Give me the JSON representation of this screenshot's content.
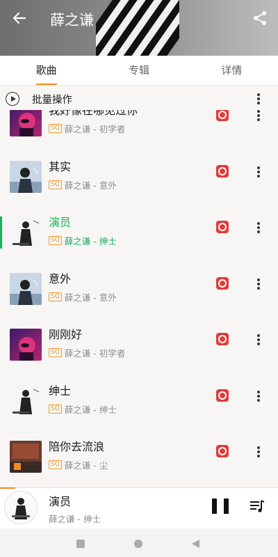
{
  "header": {
    "title": "薛之谦",
    "back_icon": "back-arrow-icon",
    "share_icon": "share-icon"
  },
  "tabs": [
    {
      "label": "歌曲",
      "active": true
    },
    {
      "label": "专辑",
      "active": false
    },
    {
      "label": "详情",
      "active": false
    }
  ],
  "batch": {
    "label": "批量操作"
  },
  "songs": [
    {
      "title": "我好像在哪见过你",
      "artist_album": "薛之谦 - 初学者",
      "quality": "SQ",
      "art": "art-pink",
      "playing": false
    },
    {
      "title": "其实",
      "artist_album": "薛之谦 - 意外",
      "quality": "SQ",
      "art": "art-blue",
      "playing": false
    },
    {
      "title": "演员",
      "artist_album": "薛之谦 - 绅士",
      "quality": "SQ",
      "art": "art-bw",
      "playing": true
    },
    {
      "title": "意外",
      "artist_album": "薛之谦 - 意外",
      "quality": "SQ",
      "art": "art-blue",
      "playing": false
    },
    {
      "title": "刚刚好",
      "artist_album": "薛之谦 - 初学者",
      "quality": "SQ",
      "art": "art-pink",
      "playing": false
    },
    {
      "title": "绅士",
      "artist_album": "薛之谦 - 绅士",
      "quality": "SQ",
      "art": "art-bw",
      "playing": false
    },
    {
      "title": "陪你去流浪",
      "artist_album": "薛之谦 - 尘",
      "quality": "SQ",
      "art": "art-dust",
      "playing": false
    }
  ],
  "player": {
    "title": "演员",
    "artist_album": "薛之谦 - 绅士",
    "progress": 0.055
  },
  "colors": {
    "accent": "#ef8a16",
    "playing": "#19b15c",
    "netease": "#e23b3b"
  }
}
